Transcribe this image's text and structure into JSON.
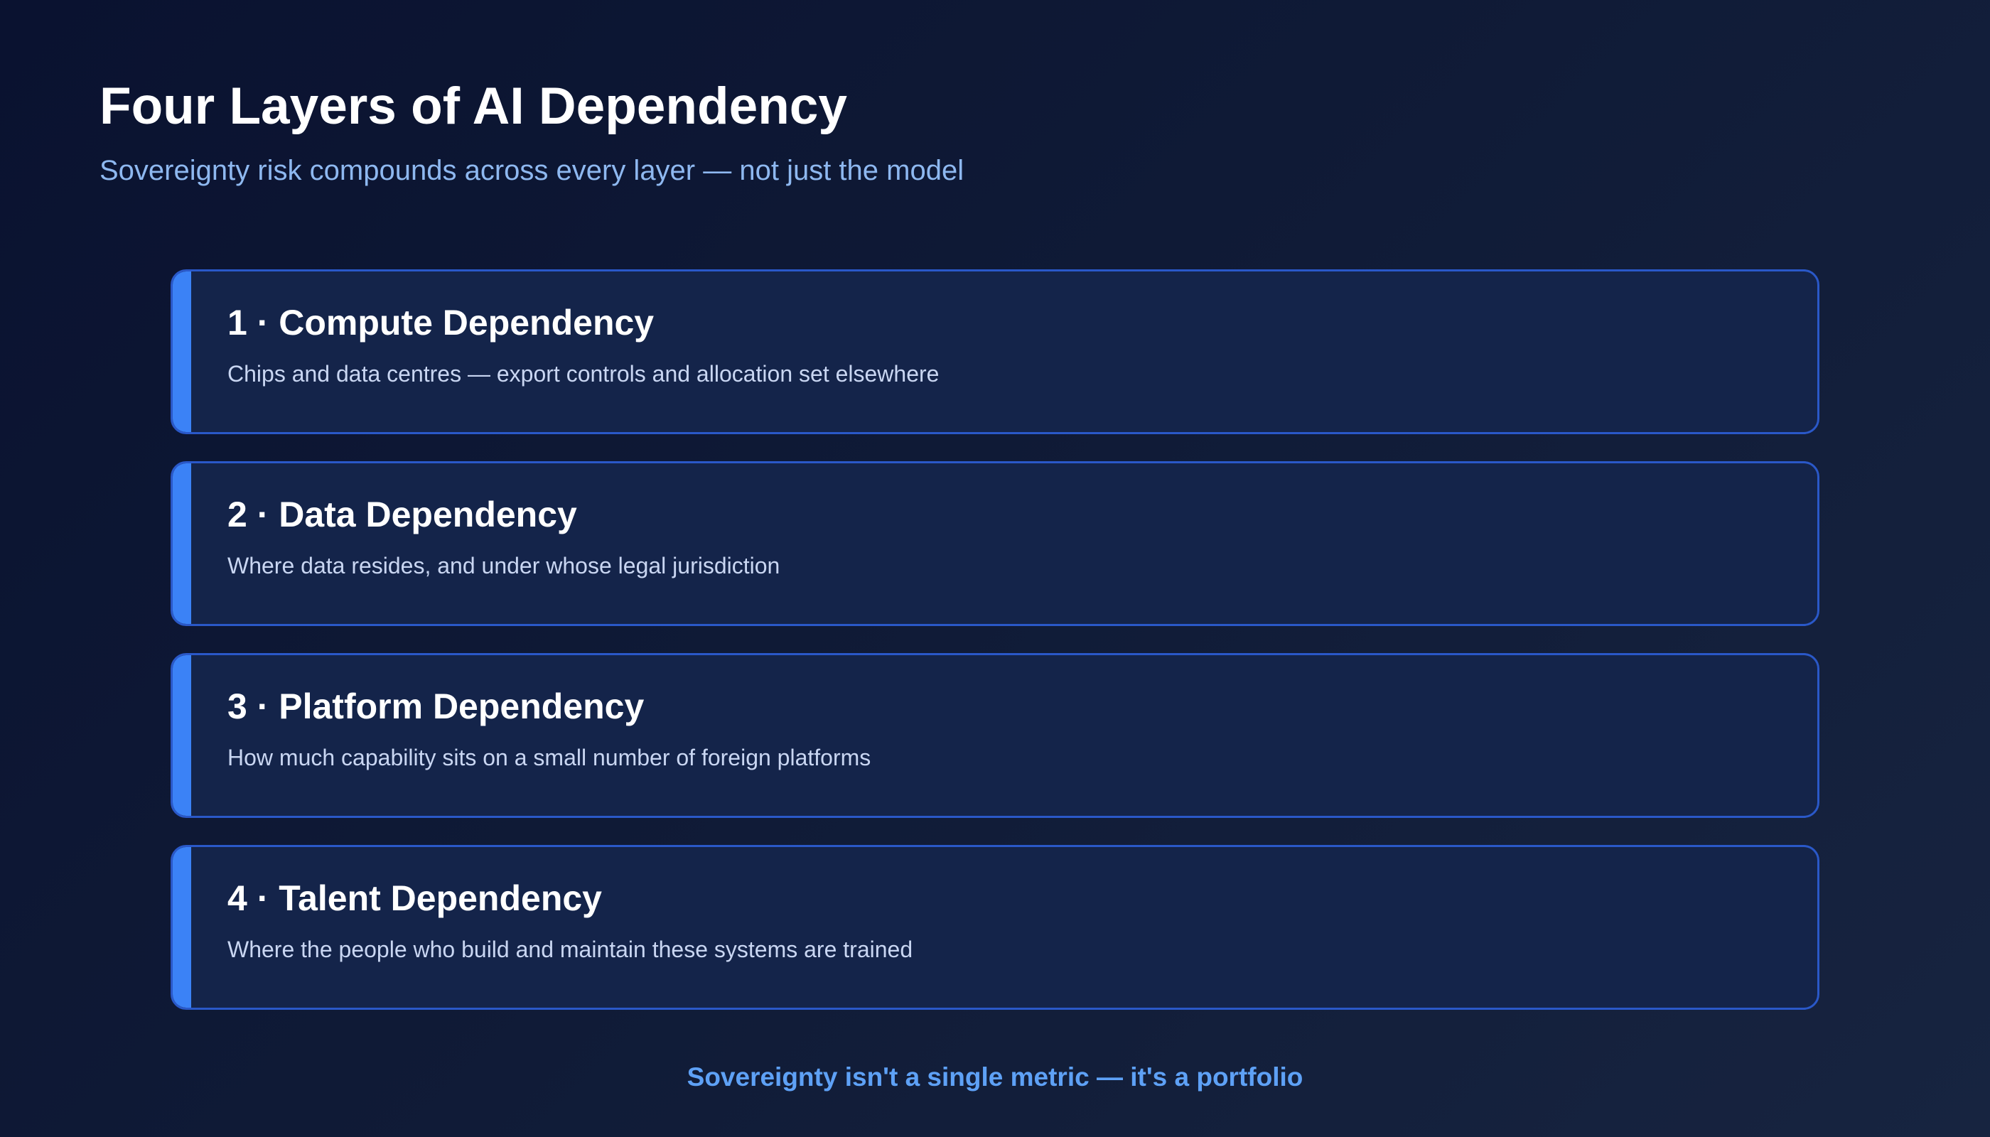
{
  "header": {
    "title": "Four Layers of AI Dependency",
    "subtitle": "Sovereignty risk compounds across every layer — not just the model"
  },
  "layers": [
    {
      "title": "1 · Compute Dependency",
      "description": "Chips and data centres — export controls and allocation set elsewhere"
    },
    {
      "title": "2 · Data Dependency",
      "description": "Where data resides, and under whose legal jurisdiction"
    },
    {
      "title": "3 · Platform Dependency",
      "description": "How much capability sits on a small number of foreign platforms"
    },
    {
      "title": "4 · Talent Dependency",
      "description": "Where the people who build and maintain these systems are trained"
    }
  ],
  "footer": {
    "note": "Sovereignty isn't a single metric — it's a portfolio"
  },
  "colors": {
    "accent": "#3b82f6",
    "card_background": "#14244a",
    "card_border": "#2a58c8",
    "subtitle": "#8eb8f0",
    "footer_text": "#5ea1f6"
  }
}
